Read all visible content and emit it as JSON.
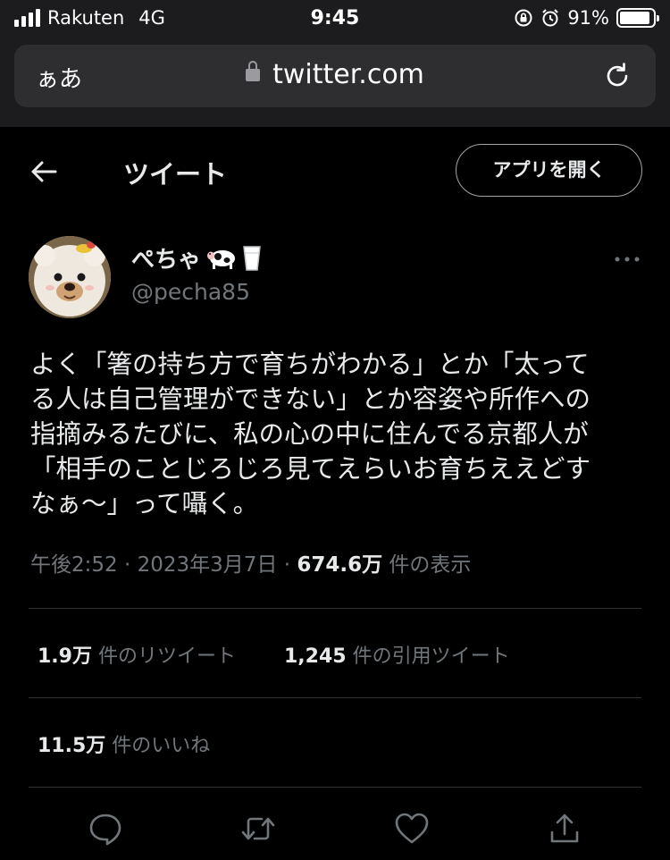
{
  "status_bar": {
    "carrier": "Rakuten",
    "network": "4G",
    "time": "9:45",
    "battery": "91%",
    "battery_level": 0.91
  },
  "browser": {
    "aa_label": "ぁあ",
    "domain": "twitter.com"
  },
  "header": {
    "title": "ツイート",
    "open_app_label": "アプリを開く"
  },
  "author": {
    "name": "ぺちゃ",
    "name_emoji": [
      "cow",
      "milk-glass"
    ],
    "handle": "@pecha85"
  },
  "tweet": {
    "text_lines": [
      "よく「箸の持ち方で育ちがわかる」とか「太って",
      "る人は自己管理ができない」とか容姿や所作への",
      "指摘みるたびに、私の心の中に住んでる京都人が",
      "「相手のことじろじろ見てえらいお育ちええどす",
      "なぁ〜」って囁く。"
    ],
    "time": "午後2:52",
    "date": "2023年3月7日",
    "views_count": "674.6万",
    "views_label": "件の表示"
  },
  "stats": {
    "retweets_count": "1.9万",
    "retweets_label": "件のリツイート",
    "quotes_count": "1,245",
    "quotes_label": "件の引用ツイート",
    "likes_count": "11.5万",
    "likes_label": "件のいいね"
  },
  "colors": {
    "background": "#000000",
    "text": "#e7e9ea",
    "muted": "#71767b",
    "divider": "#2f3336"
  }
}
